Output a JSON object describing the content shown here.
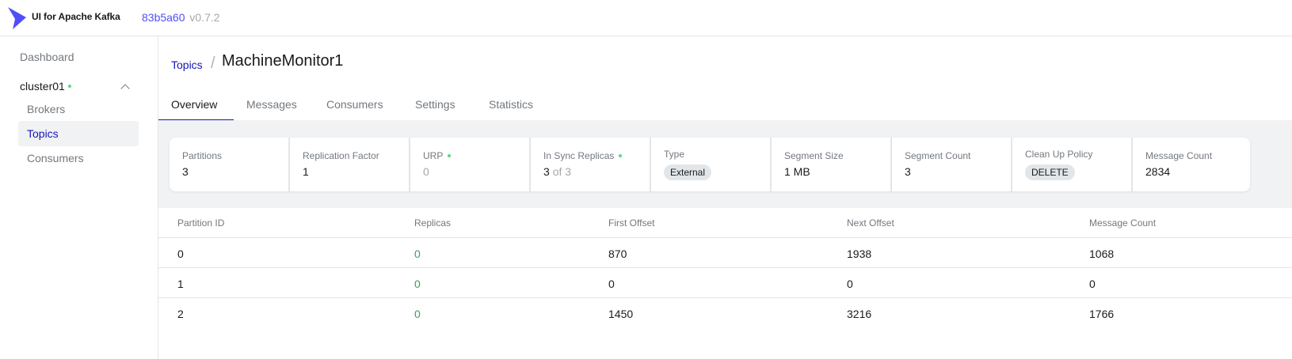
{
  "header": {
    "brand": "UI for Apache Kafka",
    "version_hash": "83b5a60",
    "version_tag": "v0.7.2",
    "logo_icon": "kafka-logo-icon",
    "accent_color": "#4f4ffa"
  },
  "sidebar": {
    "dashboard": "Dashboard",
    "cluster": {
      "name": "cluster01",
      "status_color": "#5cd685"
    },
    "items": [
      {
        "label": "Brokers",
        "active": false
      },
      {
        "label": "Topics",
        "active": true
      },
      {
        "label": "Consumers",
        "active": false
      }
    ]
  },
  "breadcrumb": {
    "parent": "Topics",
    "separator": "/",
    "title": "MachineMonitor1"
  },
  "tabs": [
    {
      "label": "Overview",
      "active": true
    },
    {
      "label": "Messages",
      "active": false
    },
    {
      "label": "Consumers",
      "active": false
    },
    {
      "label": "Settings",
      "active": false
    },
    {
      "label": "Statistics",
      "active": false
    }
  ],
  "metrics": {
    "partitions": {
      "label": "Partitions",
      "value": "3"
    },
    "replication_factor": {
      "label": "Replication Factor",
      "value": "1"
    },
    "urp": {
      "label": "URP",
      "value": "0"
    },
    "in_sync_replicas": {
      "label": "In Sync Replicas",
      "value": "3",
      "of_text": "of 3"
    },
    "type": {
      "label": "Type",
      "value": "External"
    },
    "segment_size": {
      "label": "Segment Size",
      "value": "1 MB"
    },
    "segment_count": {
      "label": "Segment Count",
      "value": "3"
    },
    "cleanup_policy": {
      "label": "Clean Up Policy",
      "value": "DELETE"
    },
    "message_count": {
      "label": "Message Count",
      "value": "2834"
    }
  },
  "table": {
    "headers": [
      "Partition ID",
      "Replicas",
      "First Offset",
      "Next Offset",
      "Message Count"
    ],
    "rows": [
      [
        "0",
        "0",
        "870",
        "1938",
        "1068"
      ],
      [
        "1",
        "0",
        "0",
        "0",
        "0"
      ],
      [
        "2",
        "0",
        "1450",
        "3216",
        "1766"
      ]
    ]
  }
}
